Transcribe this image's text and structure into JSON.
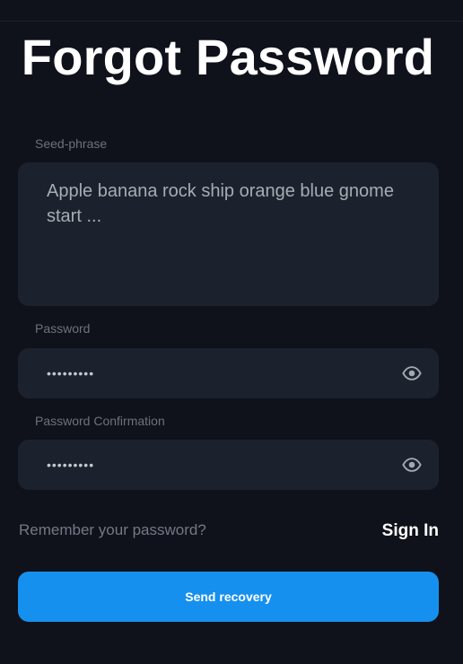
{
  "page": {
    "title": "Forgot Password"
  },
  "form": {
    "seed": {
      "label": "Seed-phrase",
      "value": "Apple banana rock ship orange blue gnome start ..."
    },
    "password": {
      "label": "Password",
      "value": "•••••••••",
      "toggle_icon": "eye-icon"
    },
    "password_confirmation": {
      "label": "Password Confirmation",
      "value": "•••••••••",
      "toggle_icon": "eye-icon"
    }
  },
  "footer": {
    "remember_text": "Remember your password?",
    "signin_link": "Sign In",
    "submit_label": "Send recovery"
  },
  "colors": {
    "background": "#0f121a",
    "field": "#1c222d",
    "accent": "#1690ee"
  }
}
